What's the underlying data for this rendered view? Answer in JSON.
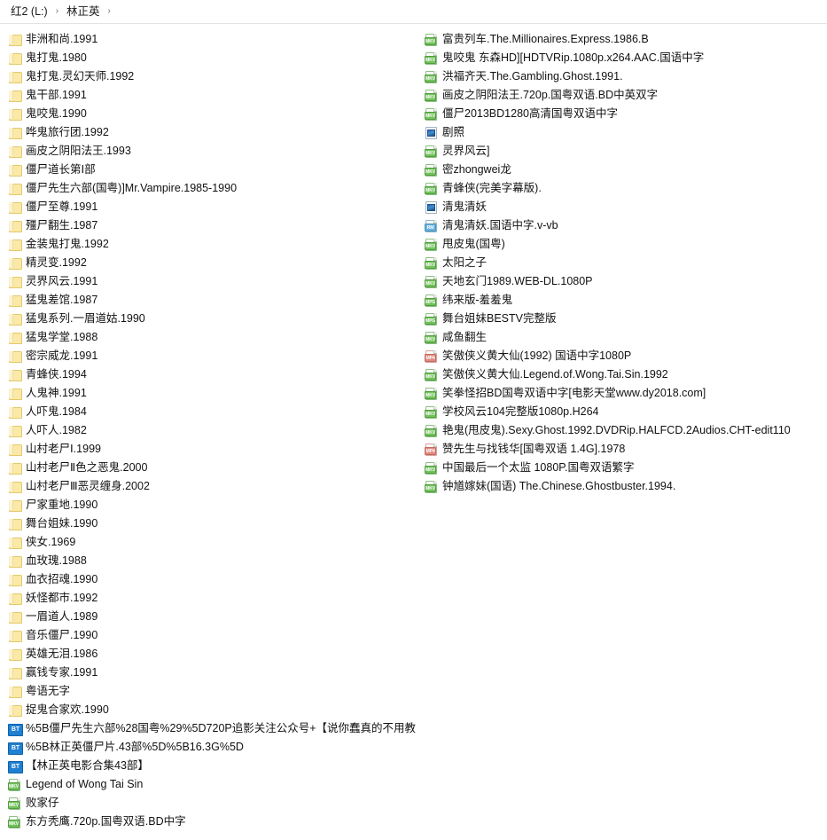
{
  "breadcrumb": {
    "items": [
      "红2 (L:)",
      "林正英"
    ],
    "separator": "›"
  },
  "columns": {
    "left": [
      {
        "icon": "folder",
        "name": "非洲和尚.1991"
      },
      {
        "icon": "folder",
        "name": "鬼打鬼.1980"
      },
      {
        "icon": "folder",
        "name": "鬼打鬼.灵幻天师.1992"
      },
      {
        "icon": "folder",
        "name": "鬼干部.1991"
      },
      {
        "icon": "folder",
        "name": "鬼咬鬼.1990"
      },
      {
        "icon": "folder",
        "name": "哗鬼旅行团.1992"
      },
      {
        "icon": "folder",
        "name": "画皮之阴阳法王.1993"
      },
      {
        "icon": "folder",
        "name": "僵尸道长第Ⅰ部"
      },
      {
        "icon": "folder",
        "name": "僵尸先生六部(国粤)]Mr.Vampire.1985-1990"
      },
      {
        "icon": "folder",
        "name": "僵尸至尊.1991"
      },
      {
        "icon": "folder",
        "name": "殭尸翻生.1987"
      },
      {
        "icon": "folder",
        "name": "金装鬼打鬼.1992"
      },
      {
        "icon": "folder",
        "name": "精灵变.1992"
      },
      {
        "icon": "folder",
        "name": "灵界风云.1991"
      },
      {
        "icon": "folder",
        "name": "猛鬼差馆.1987"
      },
      {
        "icon": "folder",
        "name": "猛鬼系列.一眉道姑.1990"
      },
      {
        "icon": "folder",
        "name": "猛鬼学堂.1988"
      },
      {
        "icon": "folder",
        "name": "密宗威龙.1991"
      },
      {
        "icon": "folder",
        "name": "青蜂侠.1994"
      },
      {
        "icon": "folder",
        "name": "人鬼神.1991"
      },
      {
        "icon": "folder",
        "name": "人吓鬼.1984"
      },
      {
        "icon": "folder",
        "name": "人吓人.1982"
      },
      {
        "icon": "folder",
        "name": "山村老尸Ⅰ.1999"
      },
      {
        "icon": "folder",
        "name": "山村老尸Ⅱ色之恶鬼.2000"
      },
      {
        "icon": "folder",
        "name": "山村老尸Ⅲ恶灵缠身.2002"
      },
      {
        "icon": "folder",
        "name": "尸家重地.1990"
      },
      {
        "icon": "folder",
        "name": "舞台姐妹.1990"
      },
      {
        "icon": "folder",
        "name": "侠女.1969"
      },
      {
        "icon": "folder",
        "name": "血玫瑰.1988"
      },
      {
        "icon": "folder",
        "name": "血衣招魂.1990"
      },
      {
        "icon": "folder",
        "name": "妖怪都市.1992"
      },
      {
        "icon": "folder",
        "name": "一眉道人.1989"
      },
      {
        "icon": "folder",
        "name": "音乐僵尸.1990"
      },
      {
        "icon": "folder",
        "name": "英雄无泪.1986"
      },
      {
        "icon": "folder",
        "name": "赢钱专家.1991"
      },
      {
        "icon": "folder",
        "name": "粤语无字"
      },
      {
        "icon": "folder",
        "name": "捉鬼合家欢.1990"
      },
      {
        "icon": "bt",
        "name": "%5B僵尸先生六部%28国粤%29%5D720P追影关注公众号+【说你蠢真的不用教"
      },
      {
        "icon": "bt",
        "name": "%5B林正英僵尸片.43部%5D%5B16.3G%5D"
      },
      {
        "icon": "bt",
        "name": "【林正英电影合集43部】"
      },
      {
        "icon": "mkv",
        "name": "Legend of Wong Tai Sin",
        "tag": "MKV"
      },
      {
        "icon": "mkv",
        "name": "败家仔",
        "tag": "MKV"
      },
      {
        "icon": "mkv",
        "name": "东方秃鹰.720p.国粤双语.BD中字",
        "tag": "MKV"
      }
    ],
    "right": [
      {
        "icon": "mkv",
        "name": "富贵列车.The.Millionaires.Express.1986.B",
        "tag": "MKV"
      },
      {
        "icon": "mkv",
        "name": "鬼咬鬼 东森HD][HDTVRip.1080p.x264.AAC.国语中字",
        "tag": "MKV"
      },
      {
        "icon": "mkv",
        "name": "洪福齐天.The.Gambling.Ghost.1991.",
        "tag": "MKV"
      },
      {
        "icon": "mkv",
        "name": "画皮之阴阳法王.720p.国粤双语.BD中英双字",
        "tag": "MKV"
      },
      {
        "icon": "mkv",
        "name": "僵尸2013BD1280高清国粤双语中字",
        "tag": "MKV"
      },
      {
        "icon": "img",
        "name": "剧照"
      },
      {
        "icon": "mkv",
        "name": "灵界风云]",
        "tag": "MKV"
      },
      {
        "icon": "mkv",
        "name": "密zhongwei龙",
        "tag": "MKV"
      },
      {
        "icon": "mkv",
        "name": "青蜂侠(完美字幕版).",
        "tag": "MKV"
      },
      {
        "icon": "img",
        "name": "清鬼清妖"
      },
      {
        "icon": "rm",
        "name": "清鬼清妖.国语中字.v-vb",
        "tag": "RM"
      },
      {
        "icon": "mkv",
        "name": "甩皮鬼(国粤)",
        "tag": "MKV"
      },
      {
        "icon": "mkv",
        "name": "太阳之子",
        "tag": "MKV"
      },
      {
        "icon": "mkv",
        "name": "天地玄门1989.WEB-DL.1080P",
        "tag": "MKV"
      },
      {
        "icon": "mpg",
        "name": "纬来版-羞羞鬼",
        "tag": "MPG"
      },
      {
        "icon": "mpg",
        "name": "舞台姐妹BESTV完整版",
        "tag": "MPG"
      },
      {
        "icon": "mkv",
        "name": "咸鱼翻生",
        "tag": "MKV"
      },
      {
        "icon": "mp4",
        "name": "笑傲侠义黄大仙(1992) 国语中字1080P",
        "tag": "MP4"
      },
      {
        "icon": "mkv",
        "name": "笑傲侠义黄大仙.Legend.of.Wong.Tai.Sin.1992",
        "tag": "MKV"
      },
      {
        "icon": "mkv",
        "name": "笑拳怪招BD国粤双语中字[电影天堂www.dy2018.com]",
        "tag": "MKV"
      },
      {
        "icon": "mkv",
        "name": "学校风云104完整版1080p.H264",
        "tag": "MKV"
      },
      {
        "icon": "mkv",
        "name": "艳鬼(甩皮鬼).Sexy.Ghost.1992.DVDRip.HALFCD.2Audios.CHT-edit110",
        "tag": "MKV"
      },
      {
        "icon": "mp4",
        "name": "赞先生与找钱华[国粤双语 1.4G].1978",
        "tag": "MP4"
      },
      {
        "icon": "mkv",
        "name": "中国最后一个太监 1080P.国粤双语繁字",
        "tag": "MKV"
      },
      {
        "icon": "mkv",
        "name": "钟馗嫁妹(国语) The.Chinese.Ghostbuster.1994.",
        "tag": "MKV"
      }
    ]
  }
}
